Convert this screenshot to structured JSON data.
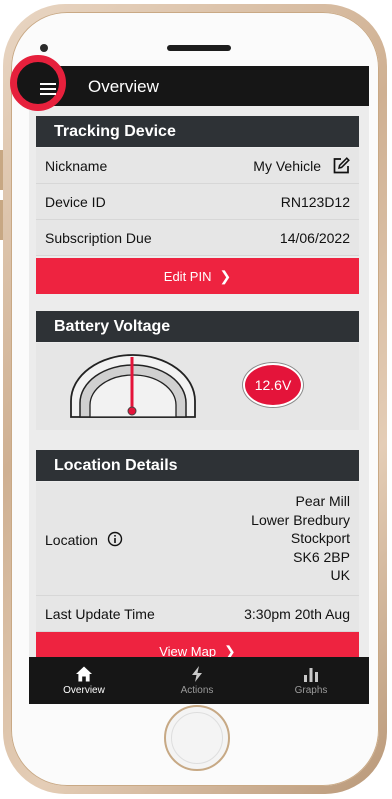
{
  "appbar": {
    "title": "Overview"
  },
  "tracking": {
    "header": "Tracking Device",
    "nickname_label": "Nickname",
    "nickname_value": "My Vehicle",
    "device_id_label": "Device ID",
    "device_id_value": "RN123D12",
    "subscription_label": "Subscription Due",
    "subscription_value": "14/06/2022",
    "edit_pin_label": "Edit PIN"
  },
  "battery": {
    "header": "Battery Voltage",
    "voltage": "12.6V"
  },
  "location": {
    "header": "Location Details",
    "location_label": "Location",
    "address": [
      "Pear Mill",
      "Lower Bredbury",
      "Stockport",
      "SK6 2BP",
      "UK"
    ],
    "last_update_label": "Last Update Time",
    "last_update_value": "3:30pm 20th Aug",
    "view_map_label": "View Map"
  },
  "bottom_nav": [
    {
      "label": "Overview",
      "icon": "home-icon",
      "active": true
    },
    {
      "label": "Actions",
      "icon": "lightning-icon",
      "active": false
    },
    {
      "label": "Graphs",
      "icon": "bar-chart-icon",
      "active": false
    }
  ],
  "colors": {
    "accent_red": "#ee2340",
    "header_dark": "#2e3236",
    "appbar": "#161616"
  }
}
